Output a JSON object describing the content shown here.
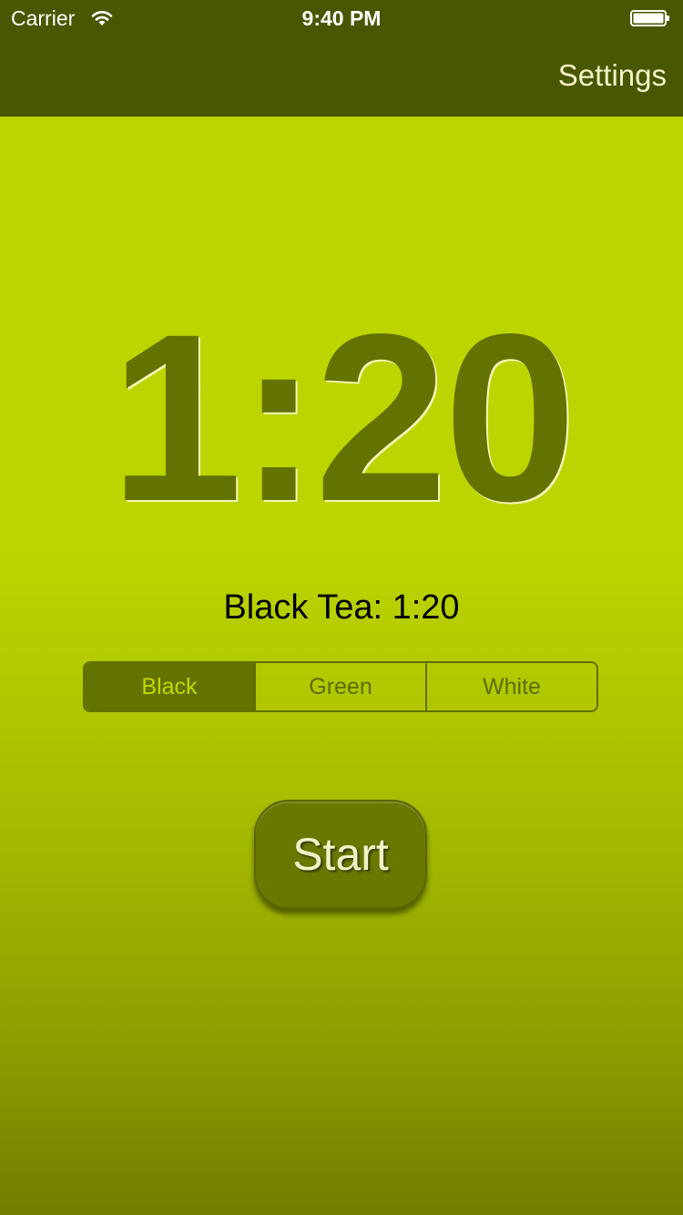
{
  "status_bar": {
    "carrier": "Carrier",
    "time": "9:40 PM",
    "wifi_icon": "wifi-icon",
    "battery_icon": "battery-icon"
  },
  "nav": {
    "settings_label": "Settings"
  },
  "timer": {
    "display": "1:20"
  },
  "tea": {
    "label": "Black Tea: 1:20"
  },
  "tea_selector": {
    "options": [
      "Black",
      "Green",
      "White"
    ],
    "selected": "Black"
  },
  "start_button": {
    "label": "Start"
  },
  "colors": {
    "nav_bar": "#485700",
    "background_top": "#bdd600",
    "background_bottom": "#727d00",
    "accent_dark": "#647200",
    "button_text": "#f3f2c7"
  }
}
